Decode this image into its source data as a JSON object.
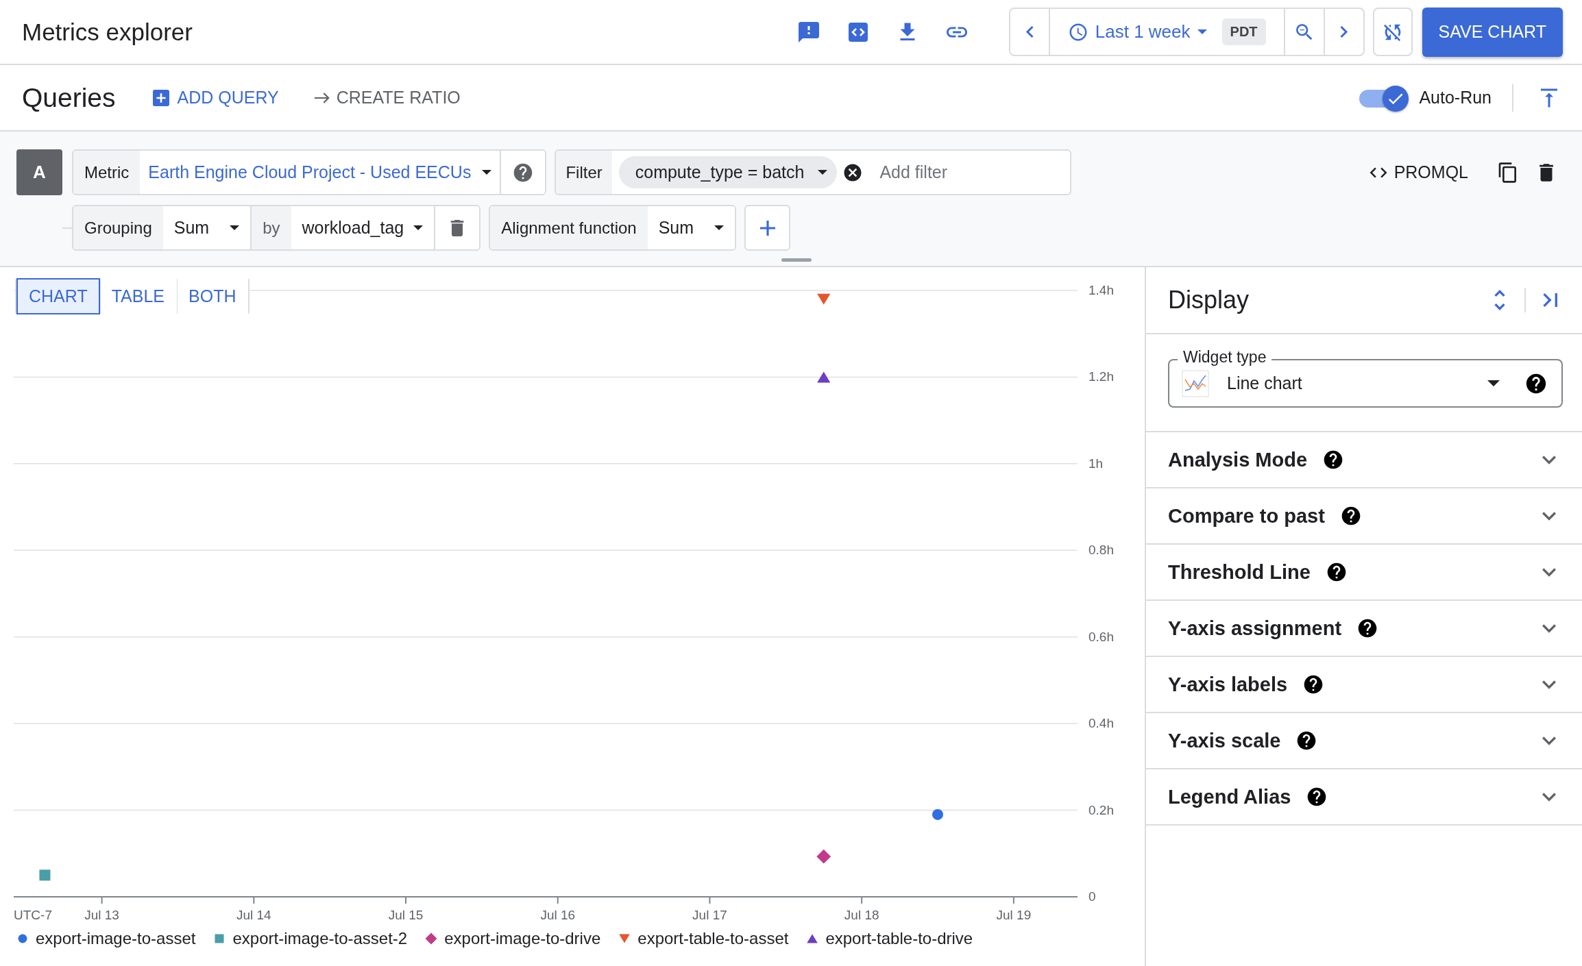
{
  "header": {
    "title": "Metrics explorer",
    "time_range": "Last 1 week",
    "timezone": "PDT",
    "save_button": "SAVE CHART"
  },
  "queries_bar": {
    "title": "Queries",
    "add_query": "ADD QUERY",
    "create_ratio": "CREATE RATIO",
    "auto_run": {
      "label": "Auto-Run",
      "on": true
    }
  },
  "query": {
    "letter": "A",
    "metric_label": "Metric",
    "metric": "Earth Engine Cloud Project - Used EECUs",
    "filter_label": "Filter",
    "filters": [
      "compute_type = batch"
    ],
    "filter_placeholder": "Add filter",
    "promql": "PROMQL",
    "grouping_label": "Grouping",
    "grouping": "Sum",
    "by_label": "by",
    "group_by": "workload_tag",
    "alignment_label": "Alignment function",
    "alignment": "Sum"
  },
  "view_tabs": [
    {
      "label": "CHART",
      "selected": true
    },
    {
      "label": "TABLE",
      "selected": false
    },
    {
      "label": "BOTH",
      "selected": false
    }
  ],
  "chart": {
    "timezone_label": "UTC-7",
    "chart_data": {
      "type": "scatter",
      "grid": true,
      "ylim": [
        0,
        1.4
      ],
      "categories": [
        null,
        null,
        null,
        null,
        "Jul 13",
        null,
        null,
        null,
        null,
        null,
        null,
        null,
        "Jul 14",
        null,
        null,
        null,
        null,
        null,
        null,
        null,
        "Jul 15",
        null,
        null,
        null,
        null,
        null,
        null,
        null,
        "Jul 16",
        null,
        null,
        null,
        null,
        null,
        null,
        null,
        "Jul 17",
        null,
        null,
        null,
        null,
        null,
        null,
        null,
        "Jul 18",
        null,
        null,
        null,
        null,
        null,
        null,
        null,
        "Jul 19",
        null,
        null,
        null
      ],
      "yticks": [
        {
          "value": 0,
          "label": "0"
        },
        {
          "value": 0.2,
          "label": "0.2h"
        },
        {
          "value": 0.4,
          "label": "0.4h"
        },
        {
          "value": 0.6,
          "label": "0.6h"
        },
        {
          "value": 0.8,
          "label": "0.8h"
        },
        {
          "value": 1,
          "label": "1h"
        },
        {
          "value": 1.2,
          "label": "1.2h"
        },
        {
          "value": 1.4,
          "label": "1.4h"
        }
      ],
      "series": [
        {
          "name": "export-image-to-asset",
          "color": "#2f6fe0",
          "marker": "circle",
          "values": [
            null,
            null,
            null,
            null,
            null,
            null,
            null,
            null,
            null,
            null,
            null,
            null,
            null,
            null,
            null,
            null,
            null,
            null,
            null,
            null,
            null,
            null,
            null,
            null,
            null,
            null,
            null,
            null,
            null,
            null,
            null,
            null,
            null,
            null,
            null,
            null,
            null,
            null,
            null,
            null,
            null,
            null,
            null,
            null,
            null,
            null,
            null,
            null,
            0.19,
            null,
            null,
            null,
            null,
            null,
            null,
            null
          ]
        },
        {
          "name": "export-image-to-asset-2",
          "color": "#4a9ea8",
          "marker": "square",
          "values": [
            null,
            0.05,
            null,
            null,
            null,
            null,
            null,
            null,
            null,
            null,
            null,
            null,
            null,
            null,
            null,
            null,
            null,
            null,
            null,
            null,
            null,
            null,
            null,
            null,
            null,
            null,
            null,
            null,
            null,
            null,
            null,
            null,
            null,
            null,
            null,
            null,
            null,
            null,
            null,
            null,
            null,
            null,
            null,
            null,
            null,
            null,
            null,
            null,
            null,
            null,
            null,
            null,
            null,
            null,
            null,
            null
          ]
        },
        {
          "name": "export-image-to-drive",
          "color": "#c23a8c",
          "marker": "diamond",
          "values": [
            null,
            null,
            null,
            null,
            null,
            null,
            null,
            null,
            null,
            null,
            null,
            null,
            null,
            null,
            null,
            null,
            null,
            null,
            null,
            null,
            null,
            null,
            null,
            null,
            null,
            null,
            null,
            null,
            null,
            null,
            null,
            null,
            null,
            null,
            null,
            null,
            null,
            null,
            null,
            null,
            null,
            null,
            0.093,
            null,
            null,
            null,
            null,
            null,
            null,
            null,
            null,
            null,
            null,
            null,
            null,
            null
          ]
        },
        {
          "name": "export-table-to-asset",
          "color": "#e4572e",
          "marker": "triangle-down",
          "values": [
            null,
            null,
            null,
            null,
            null,
            null,
            null,
            null,
            null,
            null,
            null,
            null,
            null,
            null,
            null,
            null,
            null,
            null,
            null,
            null,
            null,
            null,
            null,
            null,
            null,
            null,
            null,
            null,
            null,
            null,
            null,
            null,
            null,
            null,
            null,
            null,
            null,
            null,
            null,
            null,
            null,
            null,
            1.38,
            null,
            null,
            null,
            null,
            null,
            null,
            null,
            null,
            null,
            null,
            null,
            null,
            null
          ]
        },
        {
          "name": "export-table-to-drive",
          "color": "#6c3ec2",
          "marker": "triangle-up",
          "values": [
            null,
            null,
            null,
            null,
            null,
            null,
            null,
            null,
            null,
            null,
            null,
            null,
            null,
            null,
            null,
            null,
            null,
            null,
            null,
            null,
            null,
            null,
            null,
            null,
            null,
            null,
            null,
            null,
            null,
            null,
            null,
            null,
            null,
            null,
            null,
            null,
            null,
            null,
            null,
            null,
            null,
            null,
            1.2,
            null,
            null,
            null,
            null,
            null,
            null,
            null,
            null,
            null,
            null,
            null,
            null,
            null
          ]
        }
      ]
    }
  },
  "display_panel": {
    "title": "Display",
    "widget_type": {
      "label": "Widget type",
      "value": "Line chart"
    },
    "sections": [
      {
        "label": "Analysis Mode",
        "expanded": false
      },
      {
        "label": "Compare to past",
        "expanded": false
      },
      {
        "label": "Threshold Line",
        "expanded": false
      },
      {
        "label": "Y-axis assignment",
        "expanded": false
      },
      {
        "label": "Y-axis labels",
        "expanded": false
      },
      {
        "label": "Y-axis scale",
        "expanded": false
      },
      {
        "label": "Legend Alias",
        "expanded": false
      }
    ]
  }
}
